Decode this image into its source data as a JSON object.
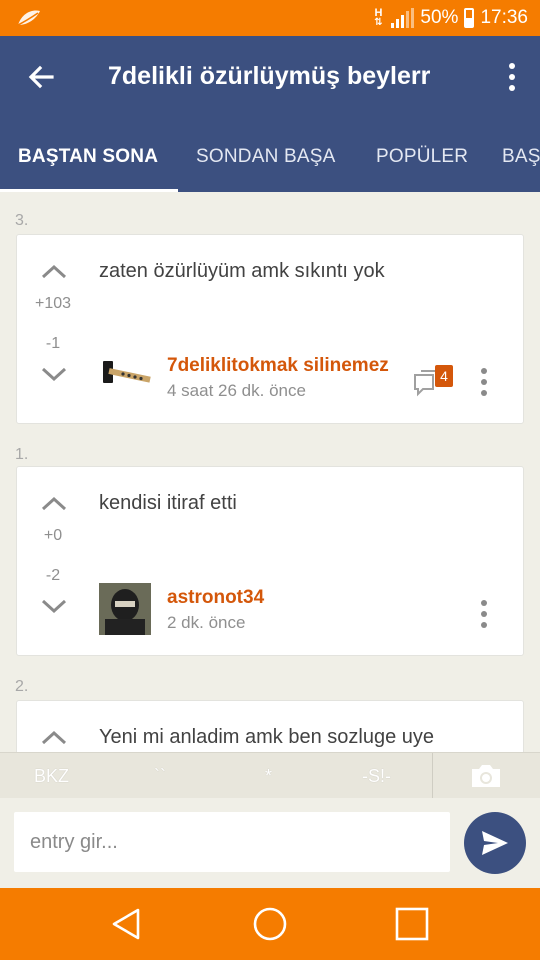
{
  "status_bar": {
    "carrier_indicator": "H",
    "battery_percent": "50%",
    "battery_level": 0.5,
    "time": "17:36",
    "icons": [
      "leaf-icon",
      "data-arrows-icon",
      "signal-icon",
      "battery-icon"
    ]
  },
  "app_bar": {
    "title": "7delikli özürlüymüş beylerr",
    "tabs": [
      {
        "label": "BAŞTAN SONA",
        "active": true
      },
      {
        "label": "SONDAN BAŞA",
        "active": false
      },
      {
        "label": "POPÜLER",
        "active": false
      },
      {
        "label": "BAŞ",
        "active": false
      }
    ],
    "colors": {
      "background": "#3c5080",
      "status": "#f57c00"
    }
  },
  "entries": [
    {
      "number": "3.",
      "text": "zaten özürlüyüm amk sıkıntı yok",
      "upvotes": "+103",
      "downvotes": "-1",
      "author": "7deliklitokmak silinemez",
      "time": "4 saat 26 dk. önce",
      "comment_count": "4",
      "avatar": "hammer-avatar"
    },
    {
      "number": "1.",
      "text": "kendisi itiraf etti",
      "upvotes": "+0",
      "downvotes": "-2",
      "author": "astronot34",
      "time": "2 dk. önce",
      "avatar": "masked-person-avatar"
    },
    {
      "number": "2.",
      "text": "Yeni mi anladim amk ben sozluge uye"
    }
  ],
  "toolbar": {
    "bkz": "BKZ",
    "backtick": "``",
    "star": "*",
    "spoiler": "-S!-",
    "camera_icon": "camera-icon"
  },
  "composer": {
    "placeholder": "entry gir...",
    "value": "",
    "send_icon": "send-icon"
  },
  "nav_bar": {
    "buttons": [
      "back-triangle-icon",
      "home-circle-icon",
      "recents-square-icon"
    ]
  },
  "accent_color": "#d4570a"
}
